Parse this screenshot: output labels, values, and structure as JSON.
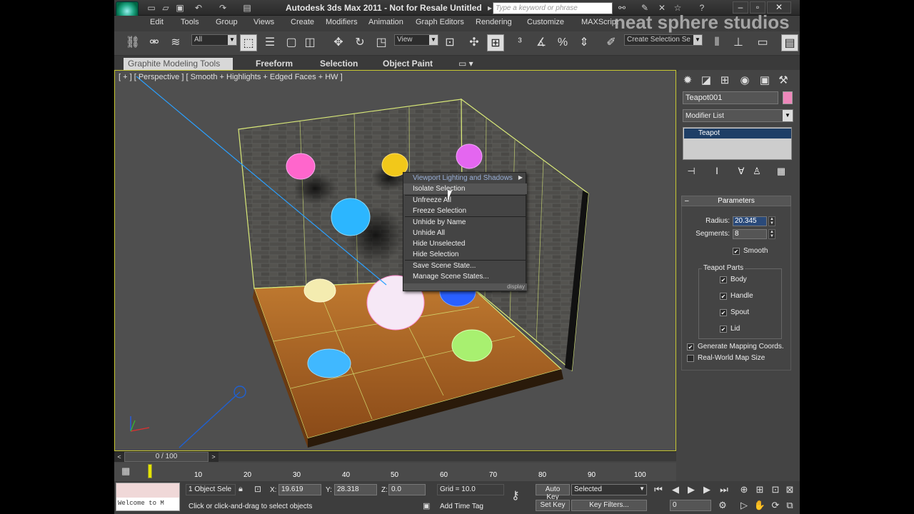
{
  "window": {
    "title": "Autodesk 3ds Max  2011   -  Not for Resale    Untitled",
    "search_placeholder": "Type a keyword or phrase",
    "brand_overlay": "neat sphere studios"
  },
  "menubar": [
    "Edit",
    "Tools",
    "Group",
    "Views",
    "Create",
    "Modifiers",
    "Animation",
    "Graph Editors",
    "Rendering",
    "Customize",
    "MAXScript"
  ],
  "toolbar": {
    "filter_value": "All",
    "view_value": "View",
    "selection_set_placeholder": "Create Selection Se"
  },
  "ribbon": {
    "tabs": [
      "Graphite Modeling Tools",
      "Freeform",
      "Selection",
      "Object Paint"
    ]
  },
  "viewport": {
    "label": "[ + ] [ Perspective ] [ Smooth + Highlights + Edged Faces + HW ]"
  },
  "context_menu": {
    "header": "Viewport Lighting and Shadows",
    "items": [
      "Isolate Selection",
      "Unfreeze All",
      "Freeze Selection",
      "Unhide by Name",
      "Unhide All",
      "Hide Unselected",
      "Hide Selection",
      "Save Scene State...",
      "Manage Scene States..."
    ],
    "footer": "display"
  },
  "command_panel": {
    "object_name": "Teapot001",
    "object_color": "#ee88bb",
    "modifier_list": "Modifier List",
    "stack_item": "Teapot",
    "parameters_title": "Parameters",
    "radius_label": "Radius:",
    "radius_value": "20.345",
    "segments_label": "Segments:",
    "segments_value": "8",
    "smooth_label": "Smooth",
    "teapot_parts_label": "Teapot Parts",
    "parts": [
      "Body",
      "Handle",
      "Spout",
      "Lid"
    ],
    "gen_mapping_label": "Generate Mapping Coords.",
    "real_world_label": "Real-World Map Size"
  },
  "timeline": {
    "frame_display": "0 / 100",
    "ticks": [
      "10",
      "20",
      "30",
      "40",
      "50",
      "60",
      "70",
      "80",
      "90",
      "100"
    ]
  },
  "status": {
    "maxscript_text": "Welcome to M",
    "selected_count": "1 Object Sele",
    "x_label": "X:",
    "x_value": "19.619",
    "y_label": "Y:",
    "y_value": "28.318",
    "z_label": "Z:",
    "z_value": "0.0",
    "grid": "Grid = 10.0",
    "prompt": "Click or click-and-drag to select objects",
    "add_time_tag": "Add Time Tag",
    "auto_key": "Auto Key",
    "selected_dropdown": "Selected",
    "set_key": "Set Key",
    "key_filters": "Key Filters...",
    "frame_field": "0"
  }
}
